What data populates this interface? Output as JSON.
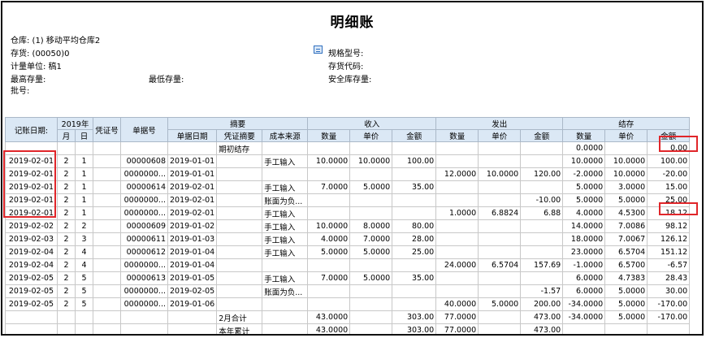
{
  "title": "明细账",
  "header": {
    "warehouse": "仓库: (1) 移动平均仓库2",
    "inventory": "存货: (00050)0",
    "unit": "计量单位: 稿1",
    "max_stock": "最高存量:",
    "min_stock": "最低存量:",
    "batch": "批号:",
    "spec": "规格型号:",
    "item_code": "存货代码:",
    "safe_stock": "安全库存量:"
  },
  "columns": {
    "date": "记账日期:",
    "year": "2019年",
    "month": "月",
    "day": "日",
    "voucher": "凭证号",
    "doc_no": "单据号",
    "summary": "摘要",
    "doc_date": "单据日期",
    "voucher_summary": "凭证摘要",
    "cost_source": "成本来源",
    "income": "收入",
    "issue": "发出",
    "balance": "结存",
    "qty": "数量",
    "price": "单价",
    "amount": "金额"
  },
  "rows": [
    {
      "date": "",
      "m": "",
      "d": "",
      "voucher": "",
      "doc": "",
      "docdate": "",
      "vsum": "期初结存",
      "src": "",
      "iq": "",
      "ip": "",
      "ia": "",
      "oq": "",
      "op": "",
      "oa": "",
      "bq": "0.0000",
      "bp": "",
      "ba": "0.00"
    },
    {
      "date": "2019-02-01",
      "m": "2",
      "d": "1",
      "voucher": "",
      "doc": "00000608",
      "docdate": "2019-01-01",
      "vsum": "",
      "src": "手工输入",
      "iq": "10.0000",
      "ip": "10.0000",
      "ia": "100.00",
      "oq": "",
      "op": "",
      "oa": "",
      "bq": "10.0000",
      "bp": "10.0000",
      "ba": "100.00"
    },
    {
      "date": "2019-02-01",
      "m": "2",
      "d": "1",
      "voucher": "",
      "doc": "0000000...",
      "docdate": "2019-01-01",
      "vsum": "",
      "src": "",
      "iq": "",
      "ip": "",
      "ia": "",
      "oq": "12.0000",
      "op": "10.0000",
      "oa": "120.00",
      "bq": "-2.0000",
      "bp": "10.0000",
      "ba": "-20.00"
    },
    {
      "date": "2019-02-01",
      "m": "2",
      "d": "1",
      "voucher": "",
      "doc": "00000614",
      "docdate": "2019-02-01",
      "vsum": "",
      "src": "手工输入",
      "iq": "7.0000",
      "ip": "5.0000",
      "ia": "35.00",
      "oq": "",
      "op": "",
      "oa": "",
      "bq": "5.0000",
      "bp": "3.0000",
      "ba": "15.00"
    },
    {
      "date": "2019-02-01",
      "m": "2",
      "d": "1",
      "voucher": "",
      "doc": "0000000...",
      "docdate": "2019-02-01",
      "vsum": "",
      "src": "账面为负...",
      "iq": "",
      "ip": "",
      "ia": "",
      "oq": "",
      "op": "",
      "oa": "-10.00",
      "bq": "5.0000",
      "bp": "5.0000",
      "ba": "25.00"
    },
    {
      "date": "2019-02-01",
      "m": "2",
      "d": "1",
      "voucher": "",
      "doc": "0000000...",
      "docdate": "2019-02-01",
      "vsum": "",
      "src": "手工输入",
      "iq": "",
      "ip": "",
      "ia": "",
      "oq": "1.0000",
      "op": "6.8824",
      "oa": "6.88",
      "bq": "4.0000",
      "bp": "4.5300",
      "ba": "18.12"
    },
    {
      "date": "2019-02-02",
      "m": "2",
      "d": "2",
      "voucher": "",
      "doc": "00000609",
      "docdate": "2019-01-02",
      "vsum": "",
      "src": "手工输入",
      "iq": "10.0000",
      "ip": "8.0000",
      "ia": "80.00",
      "oq": "",
      "op": "",
      "oa": "",
      "bq": "14.0000",
      "bp": "7.0086",
      "ba": "98.12"
    },
    {
      "date": "2019-02-03",
      "m": "2",
      "d": "3",
      "voucher": "",
      "doc": "00000611",
      "docdate": "2019-01-03",
      "vsum": "",
      "src": "手工输入",
      "iq": "4.0000",
      "ip": "7.0000",
      "ia": "28.00",
      "oq": "",
      "op": "",
      "oa": "",
      "bq": "18.0000",
      "bp": "7.0067",
      "ba": "126.12"
    },
    {
      "date": "2019-02-04",
      "m": "2",
      "d": "4",
      "voucher": "",
      "doc": "00000612",
      "docdate": "2019-01-04",
      "vsum": "",
      "src": "手工输入",
      "iq": "5.0000",
      "ip": "5.0000",
      "ia": "25.00",
      "oq": "",
      "op": "",
      "oa": "",
      "bq": "23.0000",
      "bp": "6.5704",
      "ba": "151.12"
    },
    {
      "date": "2019-02-04",
      "m": "2",
      "d": "4",
      "voucher": "",
      "doc": "0000000...",
      "docdate": "2019-01-04",
      "vsum": "",
      "src": "",
      "iq": "",
      "ip": "",
      "ia": "",
      "oq": "24.0000",
      "op": "6.5704",
      "oa": "157.69",
      "bq": "-1.0000",
      "bp": "6.5700",
      "ba": "-6.57"
    },
    {
      "date": "2019-02-05",
      "m": "2",
      "d": "5",
      "voucher": "",
      "doc": "00000613",
      "docdate": "2019-01-05",
      "vsum": "",
      "src": "手工输入",
      "iq": "7.0000",
      "ip": "5.0000",
      "ia": "35.00",
      "oq": "",
      "op": "",
      "oa": "",
      "bq": "6.0000",
      "bp": "4.7383",
      "ba": "28.43"
    },
    {
      "date": "2019-02-05",
      "m": "2",
      "d": "5",
      "voucher": "",
      "doc": "0000000...",
      "docdate": "2019-02-05",
      "vsum": "",
      "src": "账面为负...",
      "iq": "",
      "ip": "",
      "ia": "",
      "oq": "",
      "op": "",
      "oa": "-1.57",
      "bq": "6.0000",
      "bp": "5.0000",
      "ba": "30.00"
    },
    {
      "date": "2019-02-05",
      "m": "2",
      "d": "5",
      "voucher": "",
      "doc": "0000000...",
      "docdate": "2019-01-06",
      "vsum": "",
      "src": "",
      "iq": "",
      "ip": "",
      "ia": "",
      "oq": "40.0000",
      "op": "5.0000",
      "oa": "200.00",
      "bq": "-34.0000",
      "bp": "5.0000",
      "ba": "-170.00"
    },
    {
      "date": "",
      "m": "",
      "d": "",
      "voucher": "",
      "doc": "",
      "docdate": "",
      "vsum": "2月合计",
      "src": "",
      "iq": "43.0000",
      "ip": "",
      "ia": "303.00",
      "oq": "77.0000",
      "op": "",
      "oa": "473.00",
      "bq": "-34.0000",
      "bp": "5.0000",
      "ba": "-170.00"
    },
    {
      "date": "",
      "m": "",
      "d": "",
      "voucher": "",
      "doc": "",
      "docdate": "",
      "vsum": "本年累计",
      "src": "",
      "iq": "43.0000",
      "ip": "",
      "ia": "303.00",
      "oq": "77.0000",
      "op": "",
      "oa": "473.00",
      "bq": "",
      "bp": "",
      "ba": ""
    }
  ],
  "highlight_color": "#e0262a",
  "header_bg": "#dbe8f5",
  "spec_icon": "list-icon"
}
